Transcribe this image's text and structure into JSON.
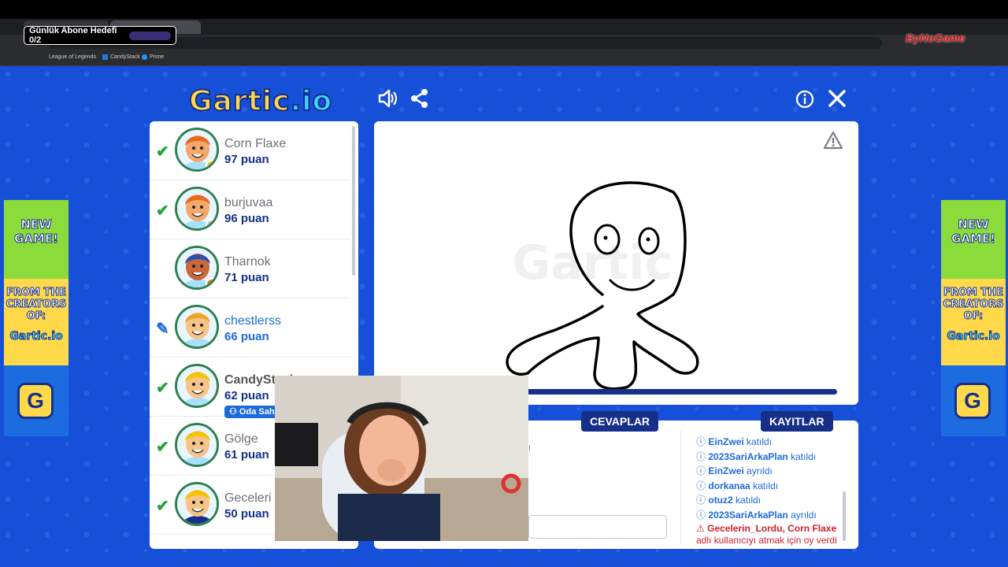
{
  "overlay": {
    "goal_label": "Günlük Abone Hedefi 0/2",
    "brand": "ByNoGame"
  },
  "browser": {
    "bookmarks": [
      "League of Legends",
      "CandyStack",
      "Prime"
    ]
  },
  "game": {
    "logo_main": "Gartic",
    "logo_suffix": ".io",
    "players": [
      {
        "name": "Corn Flaxe",
        "points": "97 puan",
        "status": "guessed",
        "skin": "#f4a86a",
        "hair": "#e56a1c",
        "shirt": "#a7e0ff",
        "badge": "#f5c400"
      },
      {
        "name": "burjuvaa",
        "points": "96 puan",
        "status": "guessed",
        "skin": "#f4a86a",
        "hair": "#e56a1c",
        "shirt": "#a7e0ff",
        "badge": "#bfbfbf"
      },
      {
        "name": "Tharnok",
        "points": "71 puan",
        "status": "none",
        "skin": "#c9683a",
        "hair": "#2d4fb0",
        "shirt": "#a7e0ff",
        "badge": "#e5730b"
      },
      {
        "name": "chestlerss",
        "points": "66 puan",
        "status": "drawing",
        "skin": "#f7c488",
        "hair": "#f1a51e",
        "shirt": "#a7e0ff",
        "badge": ""
      },
      {
        "name": "CandyStack",
        "points": "62 puan",
        "status": "guessed",
        "skin": "#f7c488",
        "hair": "#f5c400",
        "shirt": "#a7e0ff",
        "badge": "",
        "owner_label": "Oda Sahi"
      },
      {
        "name": "Gölge",
        "points": "61 puan",
        "status": "guessed",
        "skin": "#f7c488",
        "hair": "#f5c400",
        "shirt": "#a7e0ff",
        "badge": ""
      },
      {
        "name": "Geceleri",
        "points": "50 puan",
        "status": "guessed",
        "skin": "#f7c488",
        "hair": "#f5c400",
        "shirt": "#16308a",
        "badge": ""
      }
    ],
    "answers_tab": "CEVAPLAR",
    "logs_tab": "KAYITLAR",
    "answer_snippet": "!",
    "logs": [
      {
        "user": "EinZwei",
        "action": "katıldı"
      },
      {
        "user": "2023SariArkaPlan",
        "action": "katıldı"
      },
      {
        "user": "EinZwei",
        "action": "ayrıldı"
      },
      {
        "user": "dorkanaa",
        "action": "katıldı"
      },
      {
        "user": "otuz2",
        "action": "katıldı"
      },
      {
        "user": "2023SariArkaPlan",
        "action": "ayrıldı"
      }
    ],
    "warn_line1": "Gecelerin_Lordu, Corn Flaxe",
    "warn_line2": "adlı kullanıcıyı atmak için oy verdi"
  },
  "ad": {
    "line1": "NEW GAME!",
    "line2": "FROM THE CREATORS OF:",
    "line3": "Gartic.io",
    "g": "G"
  }
}
